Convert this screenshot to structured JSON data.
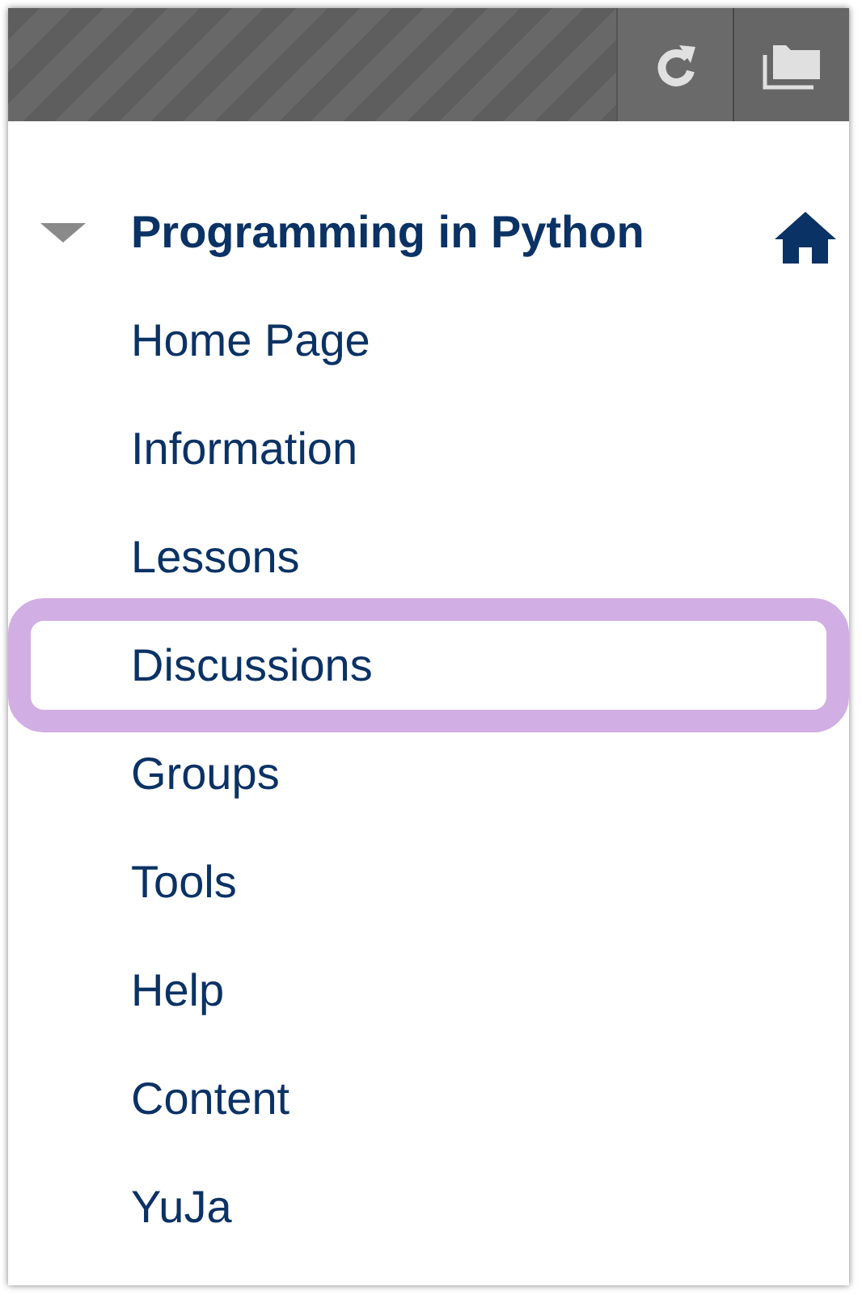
{
  "course": {
    "title": "Programming in Python",
    "expanded": true
  },
  "items": [
    {
      "label": "Home Page",
      "highlighted": false
    },
    {
      "label": "Information",
      "highlighted": false
    },
    {
      "label": "Lessons",
      "highlighted": false
    },
    {
      "label": "Discussions",
      "highlighted": true
    },
    {
      "label": "Groups",
      "highlighted": false
    },
    {
      "label": "Tools",
      "highlighted": false
    },
    {
      "label": "Help",
      "highlighted": false
    },
    {
      "label": "Content",
      "highlighted": false
    },
    {
      "label": "YuJa",
      "highlighted": false
    }
  ]
}
